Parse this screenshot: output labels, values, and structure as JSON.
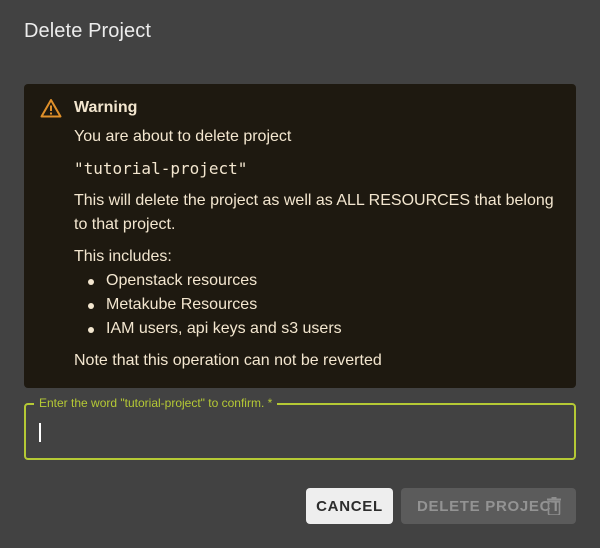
{
  "dialog": {
    "title": "Delete Project"
  },
  "warning": {
    "heading": "Warning",
    "line1": "You are about to delete project",
    "project_name": "\"tutorial-project\"",
    "line2a": "This will delete the project as well as ALL RESOURCES that belong",
    "line2b": "to that project.",
    "includes_label": "This includes:",
    "items": [
      "Openstack resources",
      "Metakube Resources",
      "IAM users, api keys and s3 users"
    ],
    "note": "Note that this operation can not be reverted"
  },
  "confirm_field": {
    "label": "Enter the word \"tutorial-project\" to confirm. *",
    "value": ""
  },
  "actions": {
    "cancel_label": "CANCEL",
    "delete_label": "DELETE PROJECT"
  },
  "colors": {
    "accent": "#b5c935",
    "warning_icon": "#e0902a",
    "dialog_bg": "#424242",
    "warning_bg": "#1e1910"
  },
  "icons": {
    "warning": "warning-triangle-icon",
    "delete": "trash-icon"
  }
}
